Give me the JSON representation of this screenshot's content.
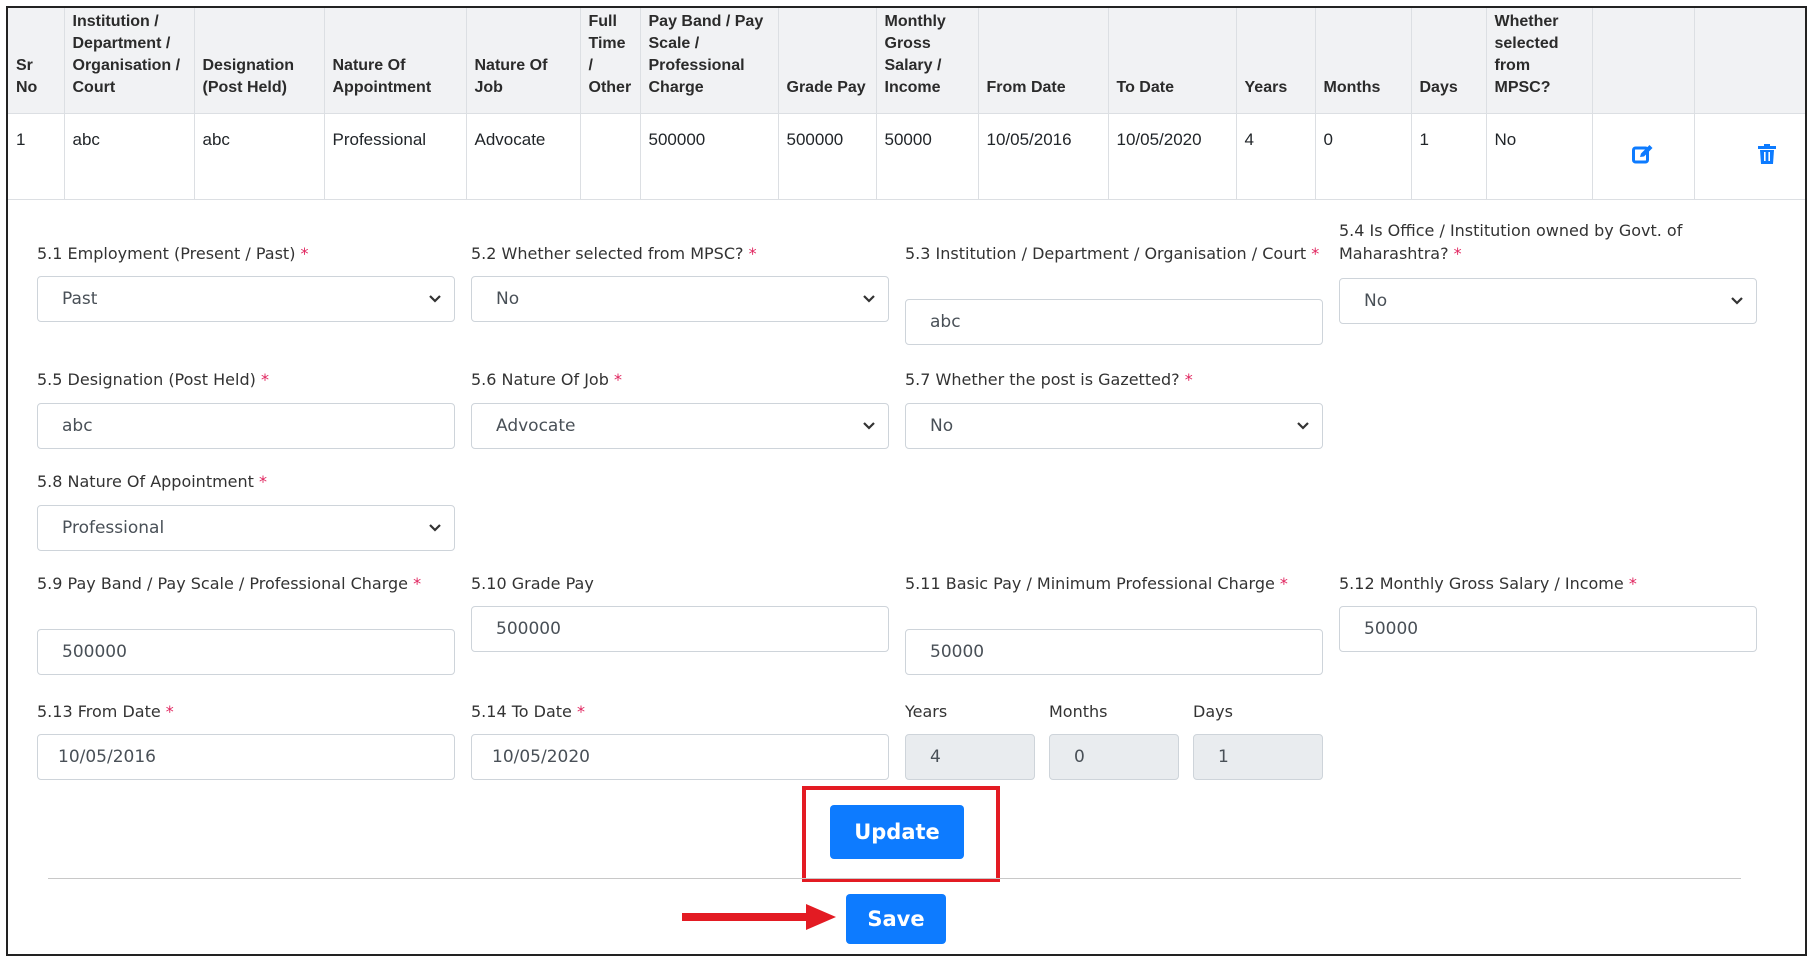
{
  "table": {
    "headers": {
      "sr_no": "Sr No",
      "institution": "Institution / Department / Organisation / Court",
      "designation": "Designation (Post Held)",
      "nature_appointment": "Nature Of Appointment",
      "nature_job": "Nature Of Job",
      "full_time": "Full Time / Other",
      "pay_band": "Pay Band / Pay Scale / Professional Charge",
      "grade_pay": "Grade Pay",
      "monthly_gross": "Monthly Gross Salary / Income",
      "from_date": "From Date",
      "to_date": "To Date",
      "years": "Years",
      "months": "Months",
      "days": "Days",
      "mpsc": "Whether selected from MPSC?"
    },
    "row": {
      "sr_no": "1",
      "institution": "abc",
      "designation": "abc",
      "nature_appointment": "Professional",
      "nature_job": "Advocate",
      "full_time": "",
      "pay_band": "500000",
      "grade_pay": "500000",
      "monthly_gross": "50000",
      "from_date": "10/05/2016",
      "to_date": "10/05/2020",
      "years": "4",
      "months": "0",
      "days": "1",
      "mpsc": "No",
      "edit_icon": "edit-icon",
      "delete_icon": "trash-icon"
    }
  },
  "form": {
    "f5_1": {
      "label": "5.1 Employment (Present / Past)",
      "value": "Past"
    },
    "f5_2": {
      "label": "5.2 Whether selected from MPSC?",
      "value": "No"
    },
    "f5_3": {
      "label": "5.3 Institution / Department / Organisation / Court",
      "value": "abc"
    },
    "f5_4": {
      "label": "5.4 Is Office / Institution owned by Govt. of Maharashtra?",
      "value": "No"
    },
    "f5_5": {
      "label": "5.5 Designation (Post Held)",
      "value": "abc"
    },
    "f5_6": {
      "label": "5.6 Nature Of Job",
      "value": "Advocate"
    },
    "f5_7": {
      "label": "5.7 Whether the post is Gazetted?",
      "value": "No"
    },
    "f5_8": {
      "label": "5.8 Nature Of Appointment",
      "value": "Professional"
    },
    "f5_9": {
      "label": "5.9  Pay Band / Pay Scale / Professional Charge",
      "value": "500000"
    },
    "f5_10": {
      "label": "5.10 Grade Pay",
      "value": "500000"
    },
    "f5_11": {
      "label": "5.11 Basic Pay / Minimum Professional Charge",
      "value": "50000"
    },
    "f5_12": {
      "label": "5.12 Monthly Gross Salary / Income",
      "value": "50000"
    },
    "f5_13": {
      "label": "5.13 From Date",
      "value": "10/05/2016"
    },
    "f5_14": {
      "label": "5.14 To Date",
      "value": "10/05/2020"
    },
    "years": {
      "label": "Years",
      "value": "4"
    },
    "months": {
      "label": "Months",
      "value": "0"
    },
    "days": {
      "label": "Days",
      "value": "1"
    },
    "required_mark": "*"
  },
  "buttons": {
    "update": "Update",
    "save": "Save"
  },
  "colors": {
    "primary": "#0d7bff",
    "highlight": "#e31b23",
    "required": "#e0245e"
  }
}
